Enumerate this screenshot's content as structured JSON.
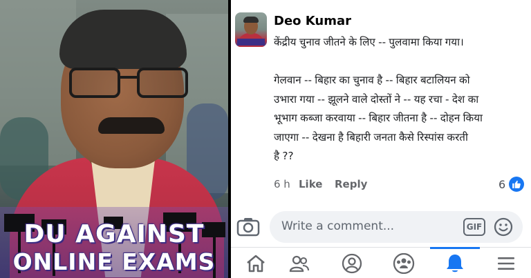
{
  "photo": {
    "overlay_line1": "DU AGAINST",
    "overlay_line2": "ONLINE EXAMS"
  },
  "comment": {
    "author": "Deo Kumar",
    "text": "केंद्रीय चुनाव जीतने के लिए -- पुलवामा किया गया।\n\nगेलवान -- बिहार का चुनाव है -- बिहार बटालियन को\nउभारा गया -- झूलने वाले दोस्तों ने -- यह रचा - देश का\nभूभाग कब्जा करवाया -- बिहार जीतना है -- दोहन किया\nजाएगा -- देखना है बिहारी जनता कैसे रिस्पांस करती\nहै ??",
    "time": "6 h",
    "like_label": "Like",
    "reply_label": "Reply",
    "reaction_count": "6",
    "reaction_icon": "thumbs-up-icon"
  },
  "composer": {
    "placeholder": "Write a comment...",
    "gif_label": "GIF",
    "camera_icon": "camera-icon",
    "emoji_icon": "smiley-icon"
  },
  "nav": {
    "items": [
      {
        "icon": "home-icon"
      },
      {
        "icon": "friends-icon"
      },
      {
        "icon": "profile-icon"
      },
      {
        "icon": "groups-icon"
      },
      {
        "icon": "bell-icon",
        "active": true
      },
      {
        "icon": "menu-icon"
      }
    ],
    "active_color": "#1877f2",
    "icon_color": "#65676b"
  }
}
